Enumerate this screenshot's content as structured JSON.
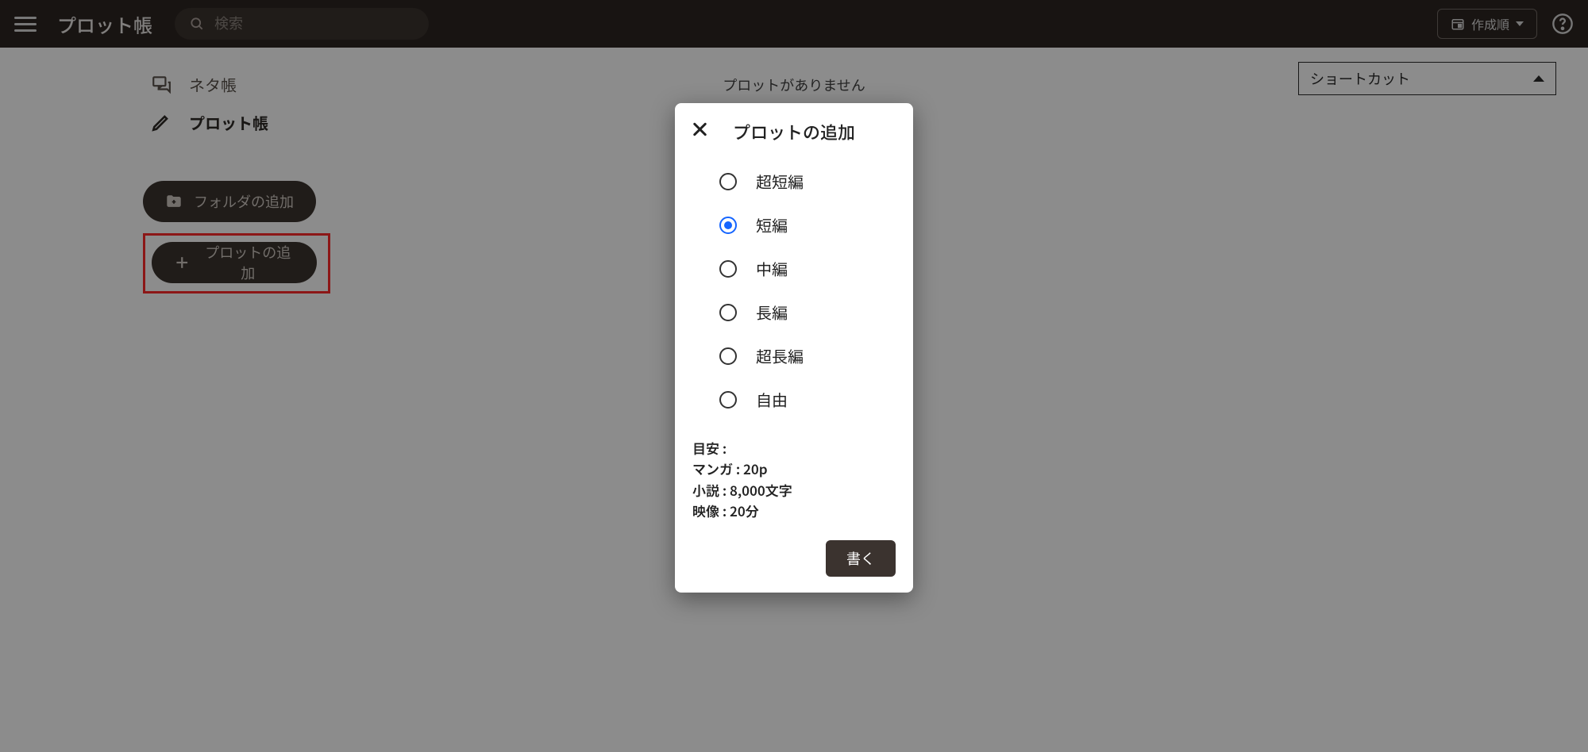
{
  "header": {
    "app_title": "プロット帳",
    "search_placeholder": "検索",
    "sort_label": "作成順"
  },
  "sidebar": {
    "item_notebook": "ネタ帳",
    "item_plotbook": "プロット帳",
    "add_folder": "フォルダの追加",
    "add_plot": "プロットの追加"
  },
  "main": {
    "empty_message": "プロットがありません",
    "shortcut_label": "ショートカット"
  },
  "dialog": {
    "title": "プロットの追加",
    "options": {
      "0": "超短編",
      "1": "短編",
      "2": "中編",
      "3": "長編",
      "4": "超長編",
      "5": "自由"
    },
    "selected_index": 1,
    "guide_heading": "目安 :",
    "guide_manga": "マンガ : 20p",
    "guide_novel": "小説 : 8,000文字",
    "guide_video": "映像 : 20分",
    "submit": "書く"
  }
}
